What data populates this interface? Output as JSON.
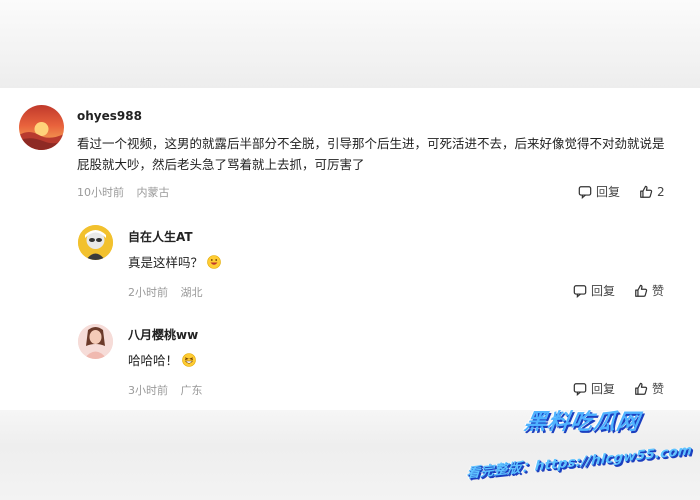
{
  "comments": [
    {
      "username": "ohyes988",
      "text": "看过一个视频，这男的就露后半部分不全脱，引导那个后生进，可死活进不去，后来好像觉得不对劲就说是屁股就大吵，然后老头急了骂着就上去抓，可厉害了",
      "time": "10小时前",
      "location": "内蒙古",
      "reply_label": "回复",
      "like_count": "2"
    }
  ],
  "replies": [
    {
      "username": "自在人生AT",
      "text": "真是这样吗？",
      "time": "2小时前",
      "location": "湖北",
      "reply_label": "回复",
      "like_label": "赞"
    },
    {
      "username": "八月樱桃ww",
      "text": "哈哈哈！",
      "time": "3小时前",
      "location": "广东",
      "reply_label": "回复",
      "like_label": "赞"
    }
  ],
  "watermark": {
    "title": "黑料吃瓜网",
    "url": "看完整版：https://hlcgw55.com"
  },
  "colors": {
    "card_bg": "#ffffff",
    "meta_text": "#9a9a9a",
    "watermark_blue": "#4fb3ff"
  }
}
